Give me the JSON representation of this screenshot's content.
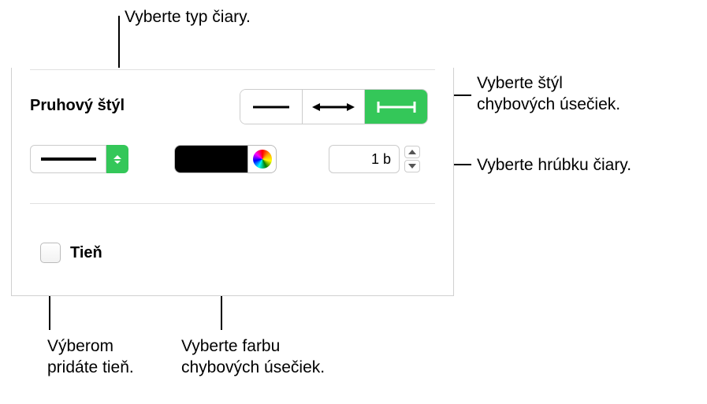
{
  "callouts": {
    "line_type": "Vyberte typ čiary.",
    "errorbar_style": "Vyberte štýl\nchybových úsečiek.",
    "line_thickness": "Vyberte hrúbku čiary.",
    "add_shadow": "Výberom\npridáte tieň.",
    "errorbar_color": "Vyberte farbu\nchybových úsečiek."
  },
  "panel": {
    "section_title": "Pruhový štýl",
    "thickness_value": "1 b",
    "shadow_label": "Tieň"
  }
}
